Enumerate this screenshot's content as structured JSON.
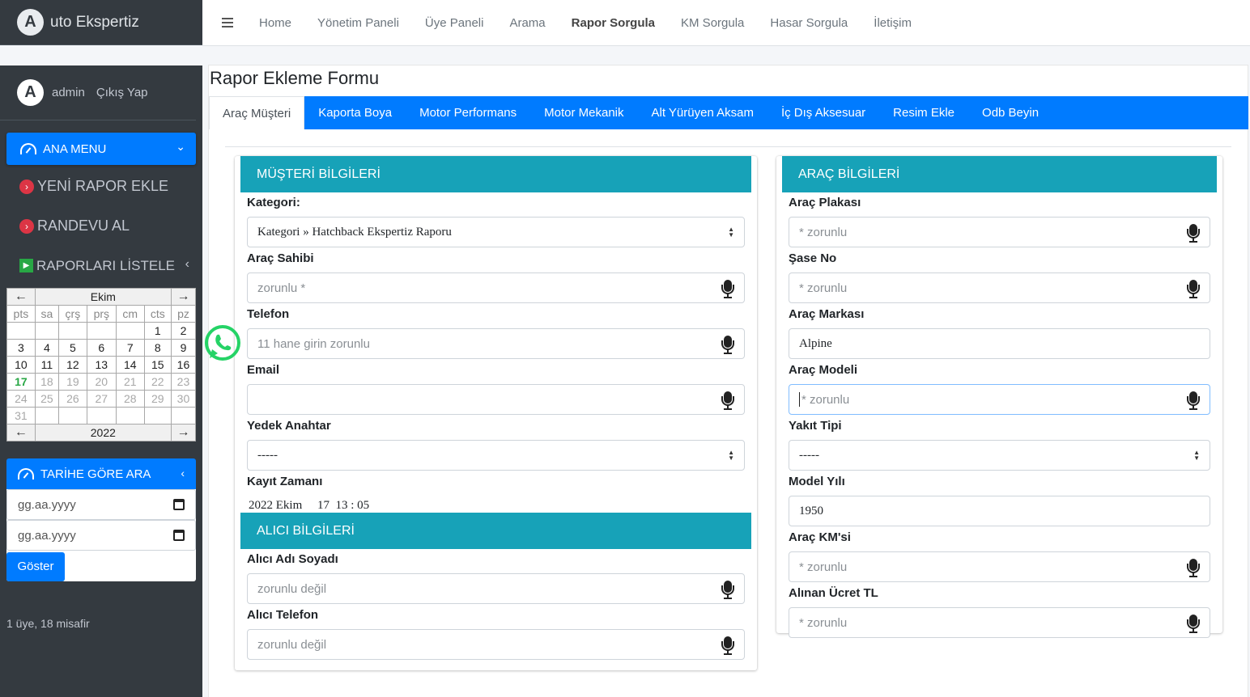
{
  "brand": {
    "logo_letter": "A",
    "text": "uto Ekspertiz"
  },
  "topnav": {
    "items": [
      "Home",
      "Yönetim Paneli",
      "Üye Paneli",
      "Arama",
      "Rapor Sorgula",
      "KM Sorgula",
      "Hasar Sorgula",
      "İletişim"
    ],
    "active": "Rapor Sorgula"
  },
  "user": {
    "avatar_letter": "A",
    "name": "admin",
    "logout": "Çıkış Yap"
  },
  "sidebar": {
    "main_menu": "ANA MENU",
    "links": [
      "YENİ RAPOR EKLE",
      "RANDEVU AL",
      "RAPORLARI LİSTELE"
    ],
    "calendar": {
      "month": "Ekim",
      "year": "2022",
      "prev_arrow": "←",
      "next_arrow": "→",
      "weekdays": [
        "pts",
        "sa",
        "çrş",
        "prş",
        "cm",
        "cts",
        "pz"
      ],
      "weeks": [
        [
          "",
          "",
          "",
          "",
          "",
          "1",
          "2"
        ],
        [
          "3",
          "4",
          "5",
          "6",
          "7",
          "8",
          "9"
        ],
        [
          "10",
          "11",
          "12",
          "13",
          "14",
          "15",
          "16"
        ],
        [
          "17",
          "18",
          "19",
          "20",
          "21",
          "22",
          "23"
        ],
        [
          "24",
          "25",
          "26",
          "27",
          "28",
          "29",
          "30"
        ],
        [
          "31",
          "",
          "",
          "",
          "",
          "",
          ""
        ]
      ],
      "today": "17"
    },
    "date_search": {
      "title": "TARİHE GÖRE ARA",
      "start_placeholder": "gg.aa.yyyy",
      "end_placeholder": "gg.aa.yyyy",
      "button": "Göster"
    },
    "online": "1 üye, 18 misafir"
  },
  "page": {
    "title": "Rapor Ekleme Formu",
    "tabs": [
      "Araç Müşteri",
      "Kaporta Boya",
      "Motor Performans",
      "Motor Mekanik",
      "Alt Yürüyen Aksam",
      "İç Dış Aksesuar",
      "Resim Ekle",
      "Odb Beyin"
    ],
    "active_tab": "Araç Müşteri"
  },
  "customer": {
    "header": "MÜŞTERİ BİLGİLERİ",
    "kategori_label": "Kategori:",
    "kategori_value": "Kategori » Hatchback Ekspertiz Raporu",
    "arac_sahibi_label": "Araç Sahibi",
    "arac_sahibi_placeholder": "zorunlu *",
    "telefon_label": "Telefon",
    "telefon_placeholder": "11 hane girin zorunlu",
    "email_label": "Email",
    "email_value": "",
    "yedek_anahtar_label": "Yedek Anahtar",
    "yedek_anahtar_value": "-----",
    "kayit_zamani_label": "Kayıt Zamanı",
    "kayit_zamani_value": "2022 Ekim     17  13 : 05"
  },
  "buyer": {
    "header": "ALICI BİLGİLERİ",
    "ad_label": "Alıcı Adı Soyadı",
    "ad_placeholder": "zorunlu değil",
    "telefon_label": "Alıcı Telefon",
    "telefon_placeholder": "zorunlu değil"
  },
  "vehicle": {
    "header": "ARAÇ BİLGİLERİ",
    "plaka_label": "Araç Plakası",
    "plaka_placeholder": "* zorunlu",
    "sase_label": "Şase No",
    "sase_placeholder": "* zorunlu",
    "marka_label": "Araç Markası",
    "marka_value": "Alpine",
    "model_label": "Araç Modeli",
    "model_placeholder": "* zorunlu",
    "yakit_label": "Yakıt Tipi",
    "yakit_value": "-----",
    "yil_label": "Model Yılı",
    "yil_value": "1950",
    "km_label": "Araç KM'si",
    "km_placeholder": "* zorunlu",
    "ucret_label": "Alınan Ücret TL",
    "ucret_placeholder": "* zorunlu"
  },
  "colors": {
    "primary": "#007bff",
    "info": "#17a2b8",
    "sidebar": "#343a40",
    "danger": "#dc3545",
    "success": "#28a745",
    "whatsapp": "#25d366"
  }
}
